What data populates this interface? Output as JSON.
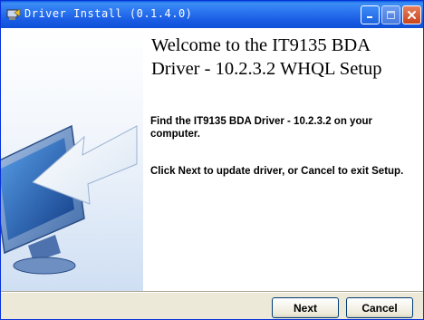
{
  "window": {
    "title": "Driver Install (0.1.4.0)"
  },
  "content": {
    "headline": "Welcome to the IT9135 BDA Driver - 10.2.3.2 WHQL Setup",
    "paragraph1": "Find the IT9135 BDA Driver - 10.2.3.2 on your computer.",
    "paragraph2": "Click Next to update driver, or Cancel to exit Setup."
  },
  "buttons": {
    "next": "Next",
    "cancel": "Cancel"
  },
  "colors": {
    "titlebar": "#2a74ef",
    "close_button": "#c8441d",
    "dialog_background": "#ece9d8"
  },
  "icons": {
    "app": "installer-icon",
    "sidebar": "monitor-arrow-icon"
  }
}
